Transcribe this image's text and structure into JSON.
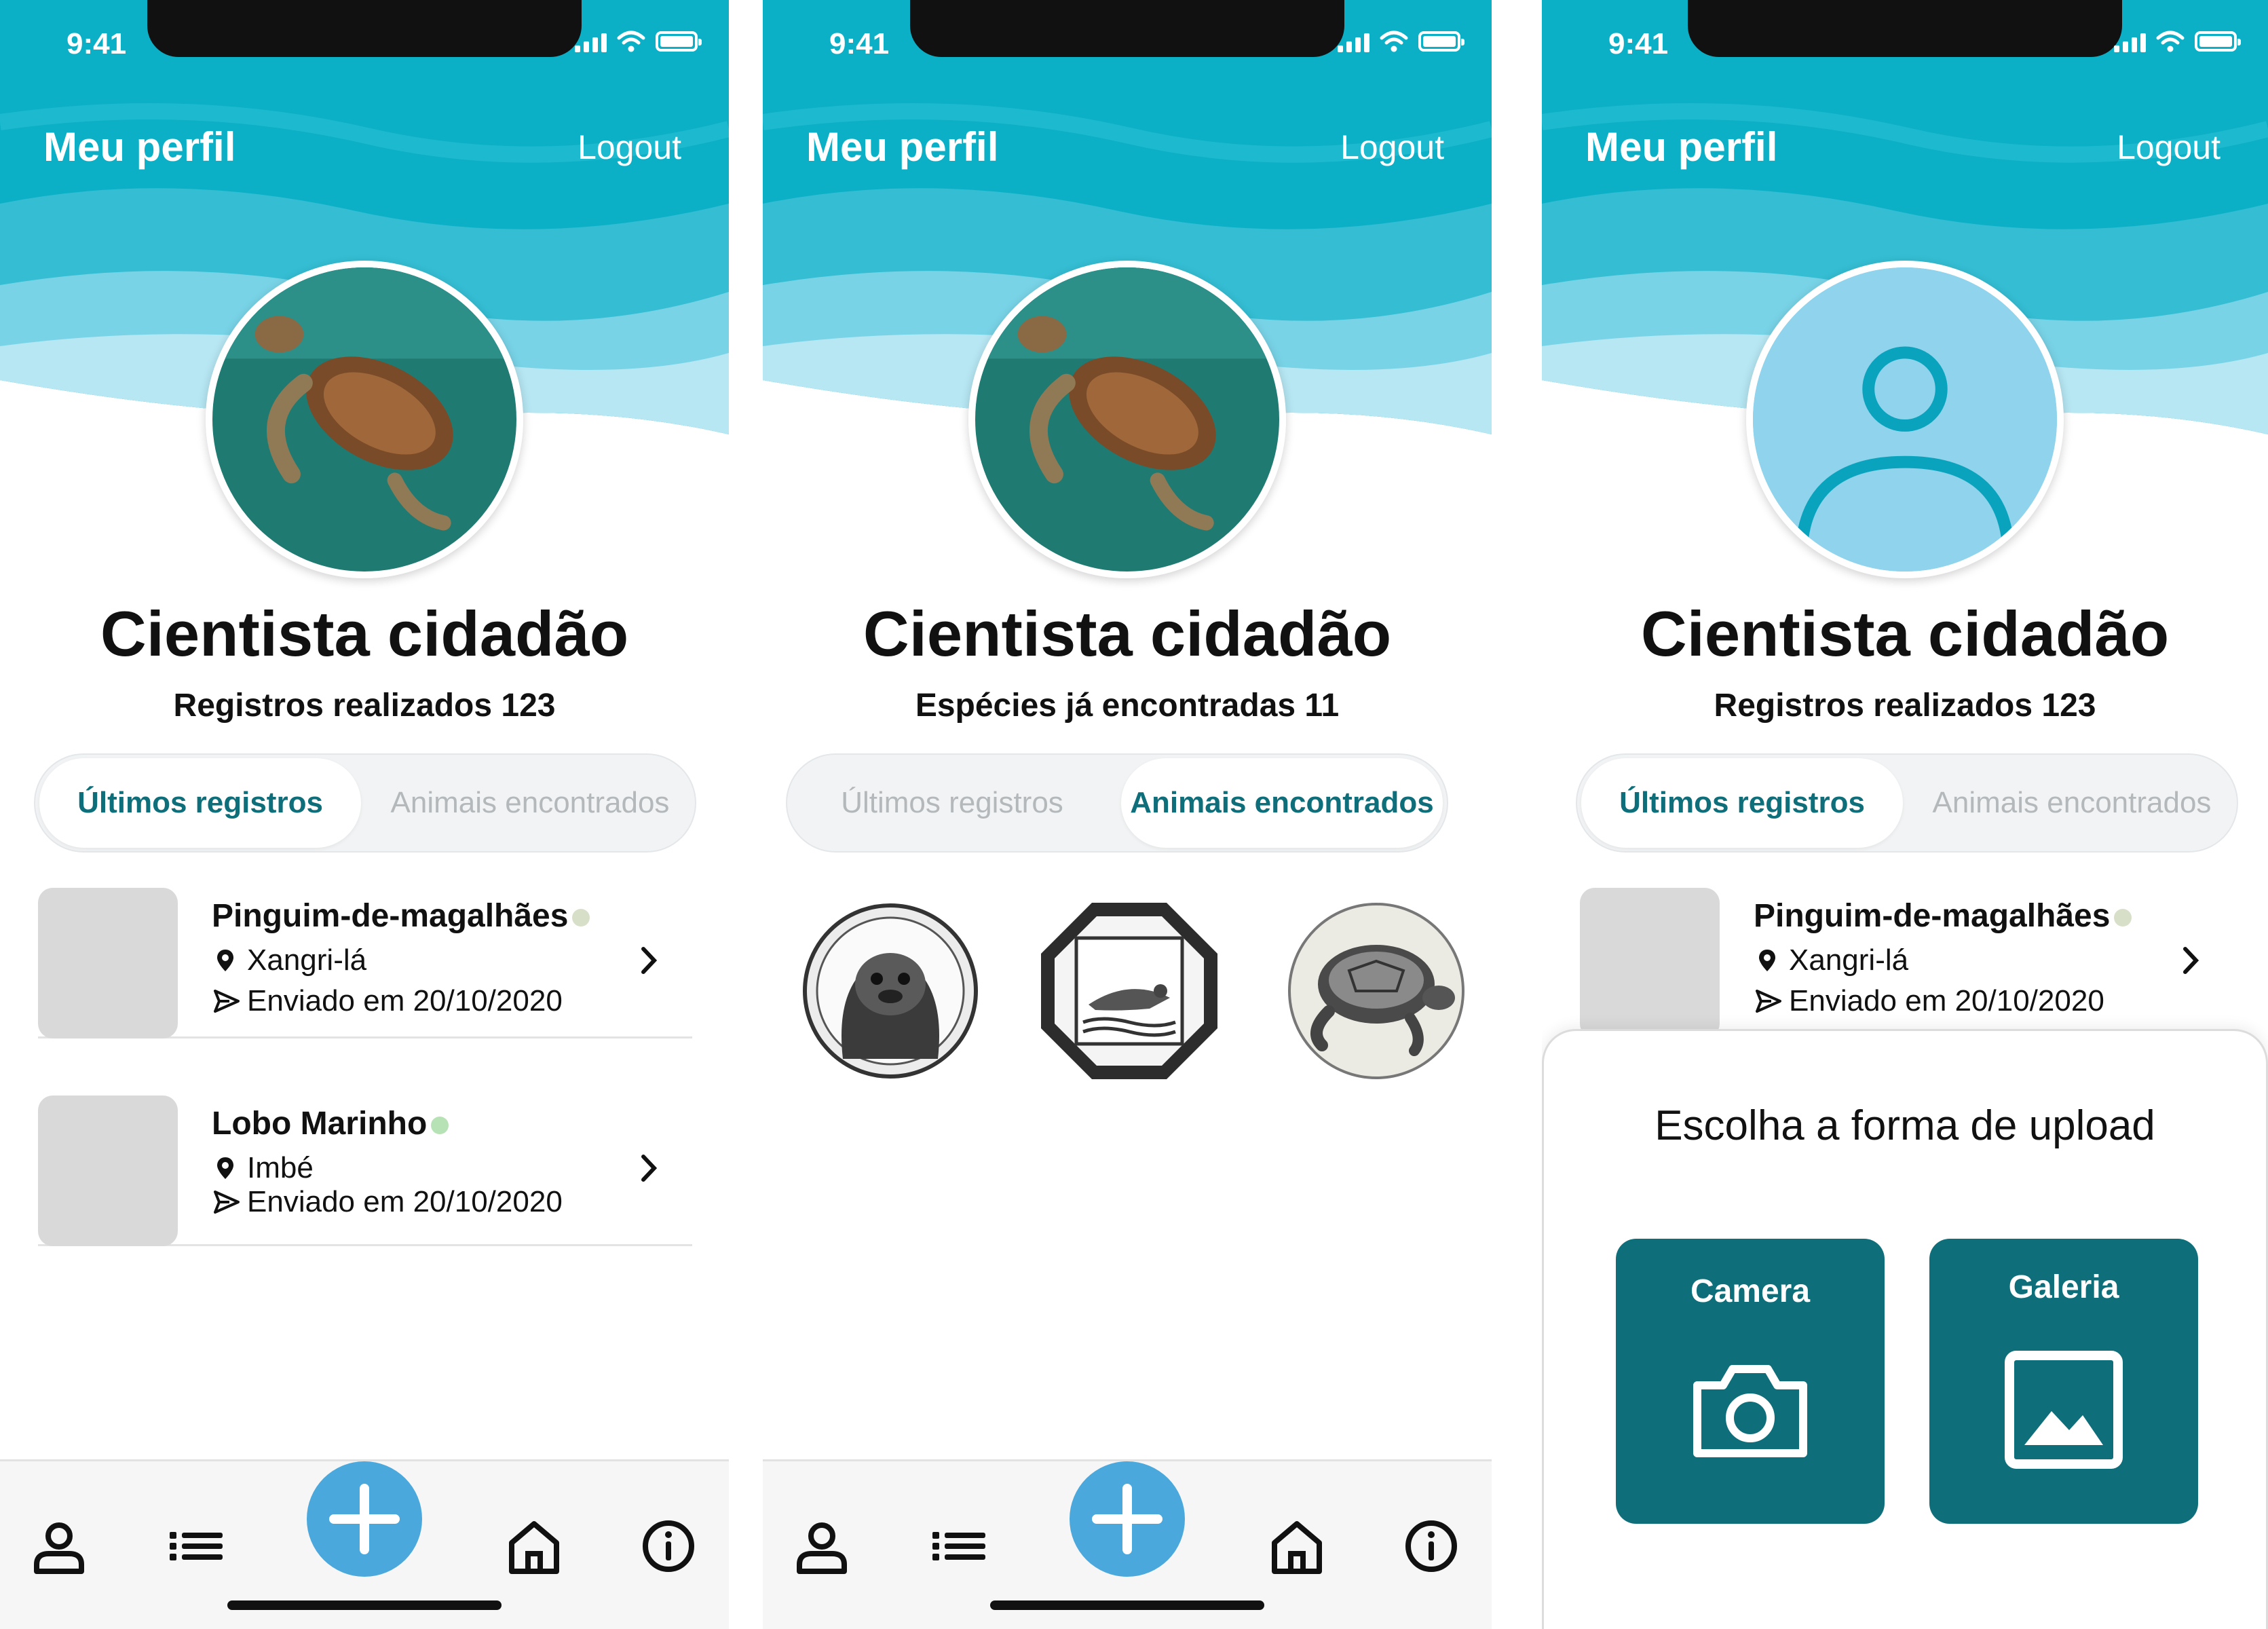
{
  "status_bar": {
    "time": "9:41"
  },
  "header": {
    "title": "Meu perfil",
    "logout": "Logout"
  },
  "profile": {
    "name": "Cientista cidadão"
  },
  "screens": [
    {
      "stat": "Registros realizados 123",
      "tabs": [
        "Últimos registros",
        "Animais encontrados"
      ],
      "active_tab": "Últimos registros",
      "records": [
        {
          "name": "Pinguim-de-magalhães",
          "status_color": "#d8dfc9",
          "location": "Xangri-lá",
          "sent": "Enviado em 20/10/2020"
        },
        {
          "name": "Lobo Marinho",
          "status_color": "#b7e2b5",
          "location": "Imbé",
          "sent": "Enviado em 20/10/2020"
        }
      ]
    },
    {
      "stat": "Espécies já encontradas 11",
      "tabs": [
        "Últimos registros",
        "Animais encontrados"
      ],
      "active_tab": "Animais encontrados",
      "badges": [
        "seal-badge-icon",
        "seagull-badge-icon",
        "turtle-badge-icon"
      ]
    },
    {
      "stat": "Registros realizados 123",
      "tabs": [
        "Últimos registros",
        "Animais encontrados"
      ],
      "active_tab": "Últimos registros",
      "records": [
        {
          "name": "Pinguim-de-magalhães",
          "status_color": "#d8dfc9",
          "location": "Xangri-lá",
          "sent": "Enviado em 20/10/2020"
        }
      ],
      "upload_sheet": {
        "title": "Escolha a forma de upload",
        "camera": "Camera",
        "gallery": "Galeria"
      }
    }
  ],
  "nav": [
    "profile-icon",
    "list-icon",
    "add-icon",
    "home-icon",
    "info-icon"
  ],
  "colors": {
    "accent": "#0e6e7a",
    "fab": "#4aa8dc",
    "header": "#12b2c8",
    "avatar_placeholder": "#8fd3ec"
  }
}
